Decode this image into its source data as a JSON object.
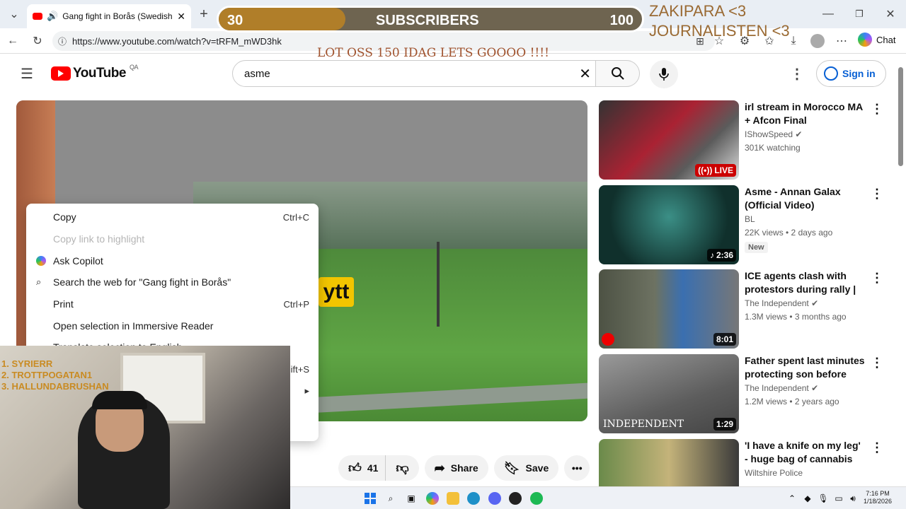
{
  "browser": {
    "tab_title": "Gang fight in Borås (Swedish",
    "url": "https://www.youtube.com/watch?v=tRFM_mWD3hk",
    "chat_label": "Chat"
  },
  "overlay": {
    "sub_current": "30",
    "sub_label": "SUBSCRIBERS",
    "sub_target": "100",
    "sub_progress": 0.3,
    "goal_text": "LOT OSS 150 IDAG LETS GOOOO !!!!",
    "name_line1": "ZAKIPARA <3",
    "name_line2": "JOURNALISTEN <3",
    "top_list": [
      "1. SYRIERR",
      "2. TROTTPOGATAN1",
      "3. HALLUNDABRUSHAN"
    ]
  },
  "youtube": {
    "logo_text": "YouTube",
    "region": "QA",
    "search_value": "asme",
    "signin_label": "Sign in"
  },
  "video": {
    "overlay_text": "ytt",
    "likes": "41",
    "share_label": "Share",
    "save_label": "Save"
  },
  "context_menu": {
    "items": [
      {
        "label": "Copy",
        "shortcut": "Ctrl+C",
        "disabled": false
      },
      {
        "label": "Copy link to highlight",
        "shortcut": "",
        "disabled": true
      },
      {
        "label": "Ask Copilot",
        "shortcut": "",
        "disabled": false
      },
      {
        "label": "Search the web for \"Gang fight in Borås\"",
        "shortcut": "",
        "disabled": false
      },
      {
        "label": "Print",
        "shortcut": "Ctrl+P",
        "disabled": false
      },
      {
        "label": "Open selection in Immersive Reader",
        "shortcut": "",
        "disabled": false
      },
      {
        "label": "Translate selection to English",
        "shortcut": "",
        "disabled": false
      },
      {
        "label": "",
        "shortcut": "ift+S",
        "disabled": false
      }
    ]
  },
  "recommendations": [
    {
      "title": "irl stream in Morocco MA + Afcon Final",
      "channel": "IShowSpeed",
      "meta": "301K watching",
      "badge": "LIVE",
      "new": ""
    },
    {
      "title": "Asme - Annan Galax (Official Video)",
      "channel": "BL",
      "meta": "22K views • 2 days ago",
      "badge": "2:36",
      "new": "New"
    },
    {
      "title": "ICE agents clash with protestors during rally | In ...",
      "channel": "The Independent",
      "meta": "1.3M views • 3 months ago",
      "badge": "8:01",
      "new": ""
    },
    {
      "title": "Father spent last minutes protecting son before bein...",
      "channel": "The Independent",
      "meta": "1.2M views • 2 years ago",
      "badge": "1:29",
      "new": ""
    },
    {
      "title": "'I have a knife on my leg' - huge bag of cannabis fou...",
      "channel": "Wiltshire Police",
      "meta": "",
      "badge": "",
      "new": ""
    }
  ],
  "thumb4_text": "INDEPENDENT",
  "taskbar": {
    "time": "7:16 PM",
    "date": "1/18/2026"
  },
  "colors": {
    "yt_red": "#ff0000",
    "link_blue": "#065fd4",
    "overlay_gold": "#b07e29"
  }
}
